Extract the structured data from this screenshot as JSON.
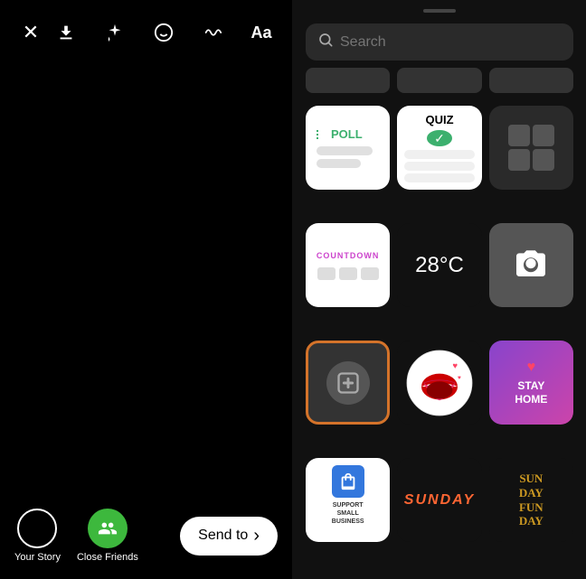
{
  "toolbar": {
    "close_label": "✕",
    "download_label": "⬇",
    "sparkle_label": "✦",
    "face_label": "☺",
    "squiggle_label": "~",
    "aa_label": "Aa"
  },
  "bottom_bar": {
    "your_story_label": "Your Story",
    "close_friends_label": "Close Friends",
    "send_to_label": "Send to",
    "send_to_arrow": "›"
  },
  "right_panel": {
    "search_placeholder": "Search",
    "stickers": [
      {
        "id": "poll",
        "type": "poll",
        "label": "POLL"
      },
      {
        "id": "quiz",
        "type": "quiz",
        "label": "QUIZ"
      },
      {
        "id": "counter",
        "type": "counter",
        "label": ""
      },
      {
        "id": "countdown",
        "type": "countdown",
        "label": "COUNTDOWN"
      },
      {
        "id": "temp",
        "type": "temp",
        "label": "28°C"
      },
      {
        "id": "camera",
        "type": "camera",
        "label": ""
      },
      {
        "id": "addphoto",
        "type": "addphoto",
        "label": ""
      },
      {
        "id": "mouth",
        "type": "mouth",
        "label": ""
      },
      {
        "id": "stayhome",
        "type": "stayhome",
        "label": "STAY HOME"
      },
      {
        "id": "support",
        "type": "support",
        "label": "SUPPORT SMALL BUSINESS"
      },
      {
        "id": "sunday",
        "type": "sunday",
        "label": "SUNDAY"
      },
      {
        "id": "sunfun",
        "type": "sunfun",
        "label": "SUN DAY FUN DAY"
      }
    ]
  }
}
